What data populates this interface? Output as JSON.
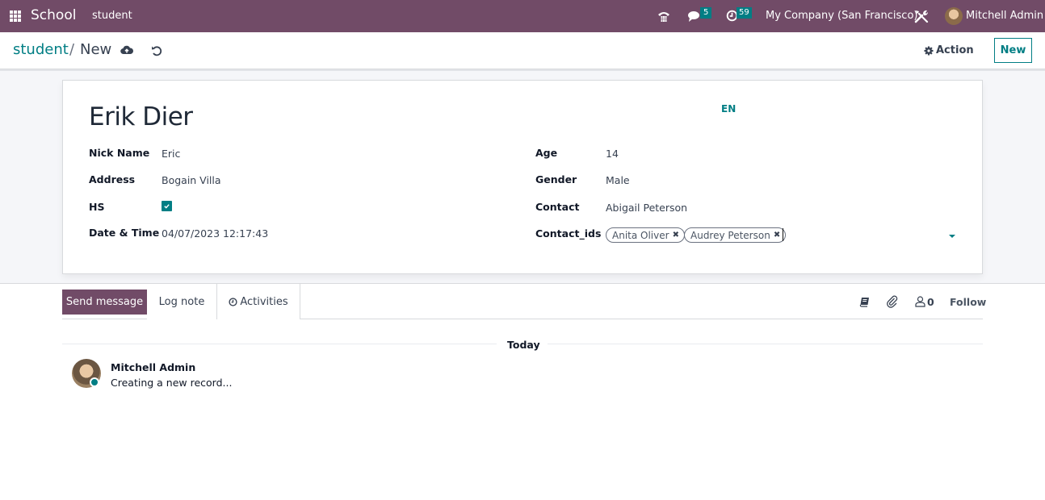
{
  "navbar": {
    "app_name": "School",
    "menu_item": "student",
    "messages_badge": "5",
    "activities_badge": "59",
    "company": "My Company (San Francisco)",
    "user": "Mitchell Admin",
    "colors": {
      "bar": "#714b67",
      "badge": "#017e84"
    }
  },
  "breadcrumb": {
    "parent": "student",
    "separator": "/",
    "current": "New"
  },
  "control": {
    "action_label": "Action",
    "new_label": "New"
  },
  "record": {
    "name": "Erik Dier",
    "lang": "EN",
    "left_fields": [
      {
        "label": "Nick Name",
        "value": "Eric"
      },
      {
        "label": "Address",
        "value": "Bogain Villa"
      },
      {
        "label": "HS",
        "value": true
      },
      {
        "label": "Date & Time",
        "value": "04/07/2023 12:17:43"
      }
    ],
    "right_fields": [
      {
        "label": "Age",
        "value": "14"
      },
      {
        "label": "Gender",
        "value": "Male"
      },
      {
        "label": "Contact",
        "value": "Abigail Peterson"
      },
      {
        "label": "Contact_ids",
        "tags": [
          "Anita Oliver",
          "Audrey Peterson"
        ]
      }
    ]
  },
  "chatter": {
    "send_message": "Send message",
    "log_note": "Log note",
    "activities": "Activities",
    "followers_count": "0",
    "follow": "Follow",
    "date_separator": "Today",
    "messages": [
      {
        "author": "Mitchell Admin",
        "body": "Creating a new record..."
      }
    ]
  }
}
